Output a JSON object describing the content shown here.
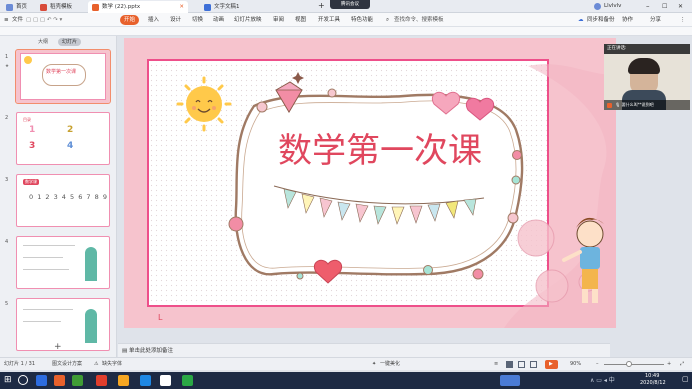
{
  "tabs": [
    {
      "label": "首页",
      "color": "#6b8bd6"
    },
    {
      "label": "稻壳模板",
      "color": "#d84b3a"
    },
    {
      "label": "数学 (22).pptx",
      "color": "#e8612c"
    },
    {
      "label": "文字文稿1",
      "color": "#3d6fd8"
    }
  ],
  "meeting_badge": "腾讯会议",
  "user_name": "Llvlvlv",
  "menu": {
    "file": "文件",
    "start": "开始",
    "items": [
      "插入",
      "设计",
      "切换",
      "动画",
      "幻灯片放映",
      "审阅",
      "视图",
      "开发工具",
      "特色功能"
    ],
    "search": "查找命令、搜索模板",
    "sync": "同步和备份",
    "collab": "协作",
    "share": "分享"
  },
  "panel_tabs": {
    "outline": "大纲",
    "slides": "幻灯片"
  },
  "thumbnails": [
    {
      "num": "1",
      "title": "数学第一次课"
    },
    {
      "num": "2",
      "title": "目录"
    },
    {
      "num": "3",
      "title": "数学课",
      "digits": "0 1 2 3 4 5 6 7 8 9"
    },
    {
      "num": "4",
      "title": ""
    },
    {
      "num": "5",
      "title": ""
    }
  ],
  "slide": {
    "title": "数学第一次课"
  },
  "video": {
    "header": "正在讲话:",
    "caption": "要什么叫**说到吧"
  },
  "notes_placeholder": "单击此处添加备注",
  "status": {
    "slide_counter": "幻灯片 1 / 31",
    "theme": "图文设计方案",
    "font_missing": "缺失字体",
    "beautify": "一键美化",
    "zoom": "90%"
  },
  "taskbar": {
    "time": "10:49",
    "date": "2020/8/12",
    "apps": [
      "#2d6cdf",
      "#e8612c",
      "#3f9c35",
      "#e03e2d",
      "#f5a623",
      "#1e88e5",
      "#ffffff",
      "#2aa845",
      "#4a7bd6"
    ]
  }
}
